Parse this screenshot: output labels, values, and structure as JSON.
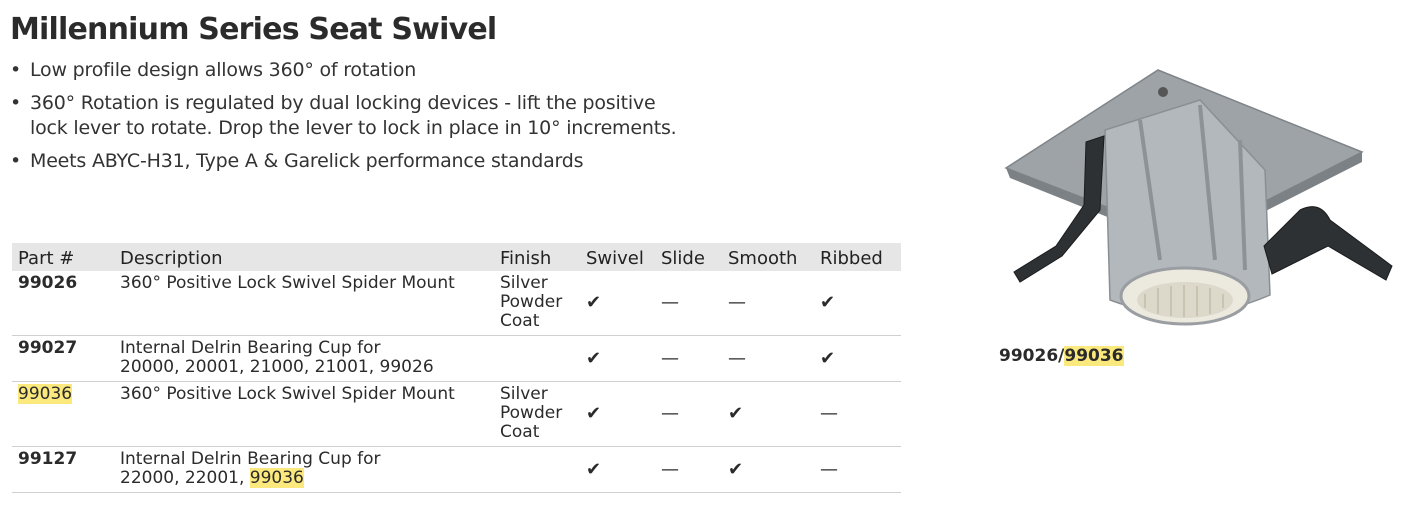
{
  "title": "Millennium Series Seat Swivel",
  "bullets": [
    "Low profile design allows 360° of rotation",
    "360° Rotation is regulated by dual locking devices - lift the positive lock lever to rotate. Drop the lever to lock in place in 10° increments.",
    "Meets ABYC-H31, Type A & Garelick performance standards"
  ],
  "table": {
    "headers": {
      "part": "Part #",
      "description": "Description",
      "finish": "Finish",
      "swivel": "Swivel",
      "slide": "Slide",
      "smooth": "Smooth",
      "ribbed": "Ribbed"
    },
    "rows": [
      {
        "part": "99026",
        "description": "360° Positive Lock Swivel Spider Mount",
        "finish": "Silver Powder Coat",
        "swivel": "✔",
        "slide": "—",
        "smooth": "—",
        "ribbed": "✔"
      },
      {
        "part": "99027",
        "description_line1": "Internal Delrin Bearing Cup for",
        "description_line2": "20000, 20001, 21000, 21001, 99026",
        "finish": "",
        "swivel": "✔",
        "slide": "—",
        "smooth": "—",
        "ribbed": "✔"
      },
      {
        "part": "99036",
        "description": "360° Positive Lock Swivel Spider Mount",
        "finish": "Silver Powder Coat",
        "swivel": "✔",
        "slide": "—",
        "smooth": "✔",
        "ribbed": "—"
      },
      {
        "part": "99127",
        "description_line1": "Internal Delrin Bearing Cup for",
        "description_line2_prefix": "22000, 22001, ",
        "description_line2_highlight": "99036",
        "finish": "",
        "swivel": "✔",
        "slide": "—",
        "smooth": "✔",
        "ribbed": "—"
      }
    ]
  },
  "image_caption": {
    "prefix": "99026/",
    "highlight": "99036"
  },
  "colors": {
    "highlight": "#fbe97d",
    "header_bg": "#e6e6e6",
    "metal": "#a9aeb2"
  }
}
